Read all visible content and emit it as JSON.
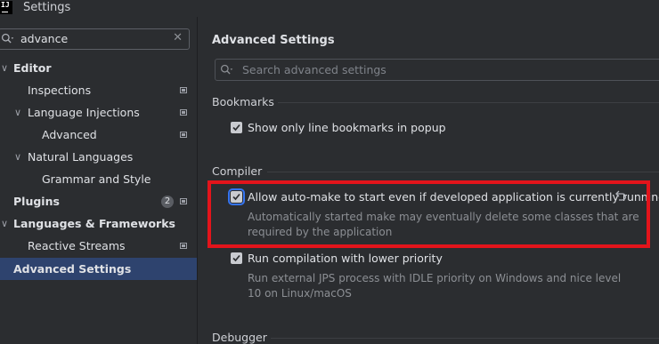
{
  "window": {
    "title": "Settings",
    "icon_text": "IJ"
  },
  "sidebar": {
    "search": {
      "value": "advance"
    },
    "items": [
      {
        "label": "Editor",
        "expanded": true
      },
      {
        "label": "Inspections"
      },
      {
        "label": "Language Injections",
        "expanded": true
      },
      {
        "label": "Advanced"
      },
      {
        "label": "Natural Languages",
        "expanded": true
      },
      {
        "label": "Grammar and Style"
      },
      {
        "label": "Plugins",
        "badge": "2"
      },
      {
        "label": "Languages & Frameworks",
        "expanded": true
      },
      {
        "label": "Reactive Streams"
      },
      {
        "label": "Advanced Settings",
        "selected": true
      }
    ]
  },
  "main": {
    "title": "Advanced Settings",
    "search_placeholder": "Search advanced settings",
    "groups": [
      {
        "title": "Bookmarks",
        "options": [
          {
            "label": "Show only line bookmarks in popup",
            "checked": true
          }
        ]
      },
      {
        "title": "Compiler",
        "options": [
          {
            "label": "Allow auto-make to start even if developed application is currently running",
            "checked": true,
            "description_lines": [
              "Automatically started make may eventually delete some classes that are",
              "required by the application"
            ]
          },
          {
            "label": "Run compilation with lower priority",
            "checked": true,
            "description_lines": [
              "Run external JPS process with IDLE priority on Windows and nice level",
              "10 on Linux/macOS"
            ]
          }
        ]
      },
      {
        "title": "Debugger"
      }
    ]
  },
  "colors": {
    "accent": "#3574f0",
    "selection": "#2e436e",
    "highlight_box": "#e3141b"
  },
  "icons": {
    "search": "search-icon",
    "clear": "close-icon",
    "undo": "undo-icon",
    "settings_page": "page-icon"
  }
}
